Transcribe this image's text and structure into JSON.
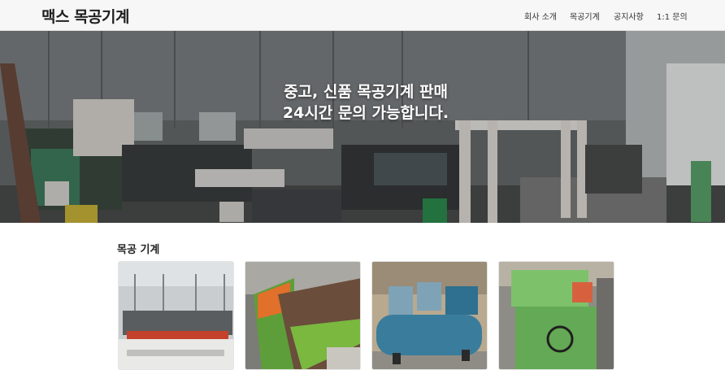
{
  "header": {
    "brand": "맥스 목공기계",
    "nav": [
      {
        "label": "회사 소개"
      },
      {
        "label": "목공기계"
      },
      {
        "label": "공지사항"
      },
      {
        "label": "1:1 문의"
      }
    ]
  },
  "hero": {
    "line1": "중고, 신품 목공기계 판매",
    "line2": "24시간 문의 가능합니다."
  },
  "section": {
    "title": "목공 기계",
    "cards": [
      {
        "image": "woodworking-machine-line-photo"
      },
      {
        "image": "green-sanding-machine-photo"
      },
      {
        "image": "blue-air-compressor-photo"
      },
      {
        "image": "green-planer-machine-photo"
      }
    ]
  }
}
